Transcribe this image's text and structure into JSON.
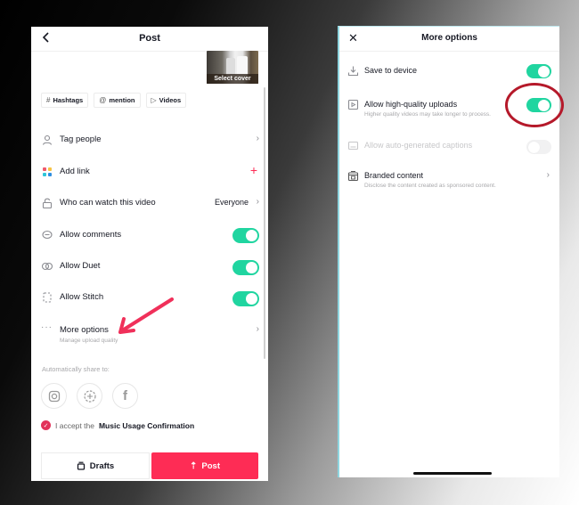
{
  "left_screen": {
    "title": "Post",
    "cover_label": "Select cover",
    "chips": [
      {
        "icon": "#",
        "label": "Hashtags"
      },
      {
        "icon": "@",
        "label": "mention"
      },
      {
        "icon": "▷",
        "label": "Videos"
      }
    ],
    "rows": {
      "tag_people": "Tag people",
      "add_link": "Add link",
      "who_can_watch": "Who can watch this video",
      "who_can_watch_value": "Everyone",
      "allow_comments": "Allow comments",
      "allow_duet": "Allow Duet",
      "allow_stitch": "Allow Stitch",
      "more_options": "More options",
      "more_options_sub": "Manage upload quality"
    },
    "toggles": {
      "allow_comments": true,
      "allow_duet": true,
      "allow_stitch": true
    },
    "share_label": "Automatically share to:",
    "accept_prefix": "I accept the",
    "accept_link": "Music Usage Confirmation",
    "drafts_label": "Drafts",
    "post_label": "Post"
  },
  "right_screen": {
    "title": "More options",
    "rows": {
      "save_to_device": "Save to device",
      "hq_uploads": "Allow high-quality uploads",
      "hq_uploads_sub": "Higher quality videos may take longer to process.",
      "auto_captions": "Allow auto-generated captions",
      "branded_content": "Branded content",
      "branded_content_sub": "Disclose the content created as sponsored content."
    },
    "toggles": {
      "save_to_device": true,
      "hq_uploads": true,
      "auto_captions": false
    }
  },
  "colors": {
    "accent_green": "#20d5a0",
    "post_red": "#fe2c55",
    "annotation_red": "#b5192a"
  }
}
